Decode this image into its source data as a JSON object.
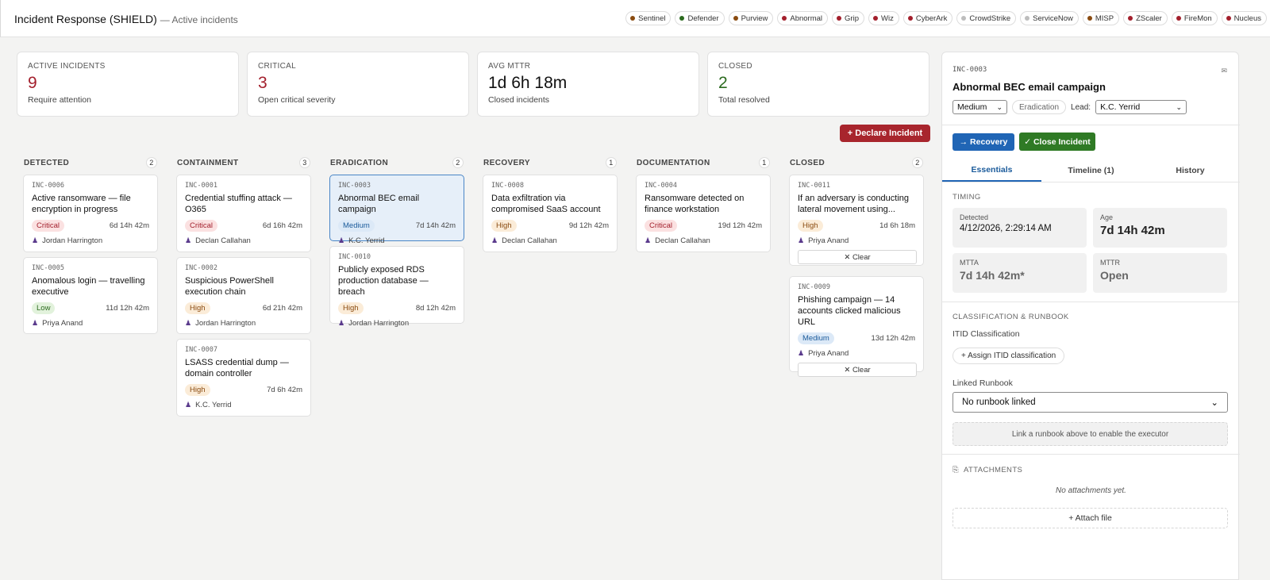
{
  "header": {
    "title": "Incident Response (SHIELD)",
    "subtitle": "— Active incidents",
    "integrations": [
      {
        "name": "Sentinel",
        "color": "#8a4b10"
      },
      {
        "name": "Defender",
        "color": "#2c6b1f"
      },
      {
        "name": "Purview",
        "color": "#8a4b10"
      },
      {
        "name": "Abnormal",
        "color": "#a31f2c"
      },
      {
        "name": "Grip",
        "color": "#a31f2c"
      },
      {
        "name": "Wiz",
        "color": "#a31f2c"
      },
      {
        "name": "CyberArk",
        "color": "#a31f2c"
      },
      {
        "name": "CrowdStrike",
        "color": "#bdbdbd"
      },
      {
        "name": "ServiceNow",
        "color": "#bdbdbd"
      },
      {
        "name": "MISP",
        "color": "#8a4b10"
      },
      {
        "name": "ZScaler",
        "color": "#a31f2c"
      },
      {
        "name": "FireMon",
        "color": "#a31f2c"
      },
      {
        "name": "Nucleus",
        "color": "#a31f2c"
      }
    ]
  },
  "stats": [
    {
      "label": "ACTIVE INCIDENTS",
      "value": "9",
      "desc": "Require attention",
      "tone": "red"
    },
    {
      "label": "CRITICAL",
      "value": "3",
      "desc": "Open critical severity",
      "tone": "red"
    },
    {
      "label": "AVG MTTR",
      "value": "1d 6h 18m",
      "desc": "Closed incidents",
      "tone": "dark"
    },
    {
      "label": "CLOSED",
      "value": "2",
      "desc": "Total resolved",
      "tone": "green"
    }
  ],
  "declare_label": "+ Declare Incident",
  "columns": [
    {
      "name": "DETECTED",
      "count": "2",
      "cards": [
        {
          "id": "INC-0006",
          "title": "Active ransomware — file encryption in progress",
          "severity": "Critical",
          "age": "6d 14h 42m",
          "owner": "Jordan Harrington"
        },
        {
          "id": "INC-0005",
          "title": "Anomalous login — travelling executive",
          "severity": "Low",
          "age": "11d 12h 42m",
          "owner": "Priya Anand"
        }
      ]
    },
    {
      "name": "CONTAINMENT",
      "count": "3",
      "cards": [
        {
          "id": "INC-0001",
          "title": "Credential stuffing attack — O365",
          "severity": "Critical",
          "age": "6d 16h 42m",
          "owner": "Declan Callahan"
        },
        {
          "id": "INC-0002",
          "title": "Suspicious PowerShell execution chain",
          "severity": "High",
          "age": "6d 21h 42m",
          "owner": "Jordan Harrington"
        },
        {
          "id": "INC-0007",
          "title": "LSASS credential dump — domain controller",
          "severity": "High",
          "age": "7d 6h 42m",
          "owner": "K.C. Yerrid"
        }
      ]
    },
    {
      "name": "ERADICATION",
      "count": "2",
      "cards": [
        {
          "id": "INC-0003",
          "title": "Abnormal BEC email campaign",
          "severity": "Medium",
          "age": "7d 14h 42m",
          "owner": "K.C. Yerrid"
        },
        {
          "id": "INC-0010",
          "title": "Publicly exposed RDS production database — breach",
          "severity": "High",
          "age": "8d 12h 42m",
          "owner": "Jordan Harrington"
        }
      ]
    },
    {
      "name": "RECOVERY",
      "count": "1",
      "cards": [
        {
          "id": "INC-0008",
          "title": "Data exfiltration via compromised SaaS account",
          "severity": "High",
          "age": "9d 12h 42m",
          "owner": "Declan Callahan"
        }
      ]
    },
    {
      "name": "DOCUMENTATION",
      "count": "1",
      "cards": [
        {
          "id": "INC-0004",
          "title": "Ransomware detected on finance workstation",
          "severity": "Critical",
          "age": "19d 12h 42m",
          "owner": "Declan Callahan"
        }
      ]
    },
    {
      "name": "CLOSED",
      "count": "2",
      "cards": [
        {
          "id": "INC-0011",
          "title": "If an adversary is conducting lateral movement using...",
          "severity": "High",
          "age": "1d 6h 18m",
          "owner": "Priya Anand",
          "clear": "✕ Clear"
        },
        {
          "id": "INC-0009",
          "title": "Phishing campaign — 14 accounts clicked malicious URL",
          "severity": "Medium",
          "age": "13d 12h 42m",
          "owner": "Priya Anand",
          "clear": "✕ Clear"
        }
      ]
    }
  ],
  "panel": {
    "id": "INC-0003",
    "title": "Abnormal BEC email campaign",
    "severity": "Medium",
    "phase": "Eradication",
    "lead_label": "Lead:",
    "lead": "K.C. Yerrid",
    "recovery_btn": "→ Recovery",
    "close_btn": "✓ Close Incident",
    "tabs": [
      "Essentials",
      "Timeline (1)",
      "History"
    ],
    "timing_head": "TIMING",
    "detected_lbl": "Detected",
    "detected": "4/12/2026, 2:29:14 AM",
    "age_lbl": "Age",
    "age": "7d 14h 42m",
    "mtta_lbl": "MTTA",
    "mtta": "7d 14h 42m*",
    "mttr_lbl": "MTTR",
    "mttr": "Open",
    "class_head": "CLASSIFICATION & RUNBOOK",
    "itid_lbl": "ITID Classification",
    "assign_btn": "+ Assign ITID classification",
    "runbook_lbl": "Linked Runbook",
    "runbook_value": "No runbook linked",
    "runbook_hint": "Link a runbook above to enable the executor",
    "attach_head": "ATTACHMENTS",
    "no_attach": "No attachments yet.",
    "attach_btn": "+ Attach file"
  }
}
